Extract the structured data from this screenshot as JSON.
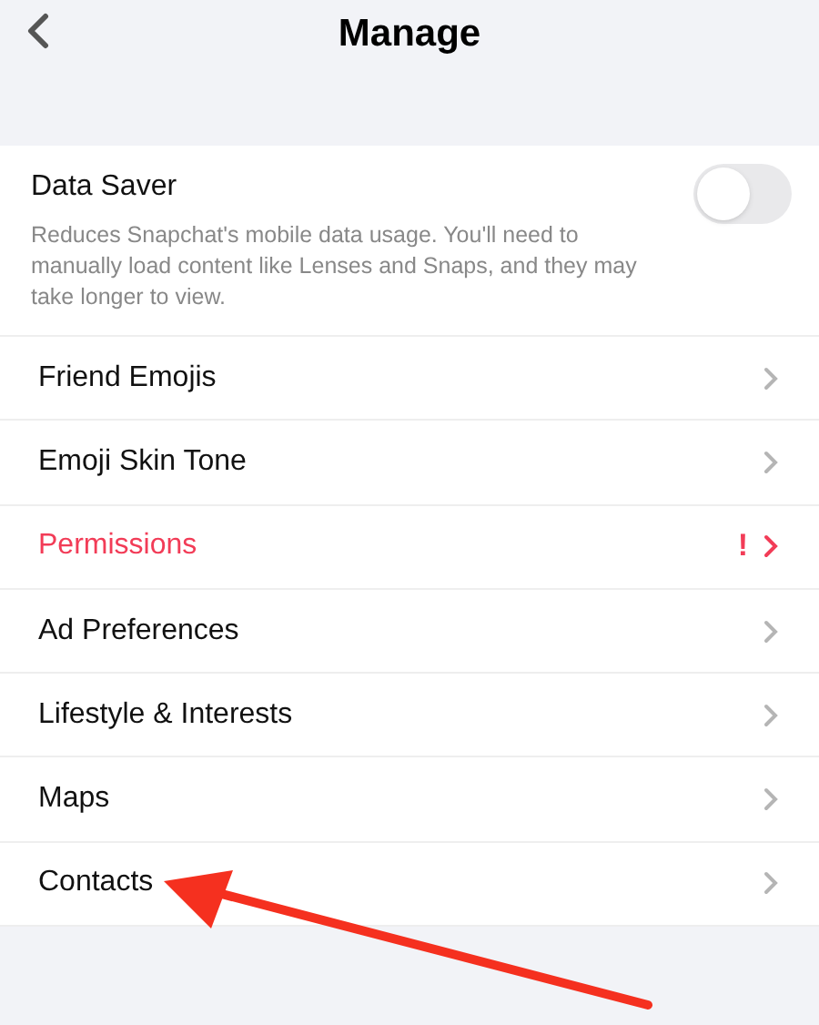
{
  "header": {
    "title": "Manage"
  },
  "data_saver": {
    "label": "Data Saver",
    "on": false,
    "description": "Reduces Snapchat's mobile data usage. You'll need to manually load content like Lenses and Snaps, and they may take longer to view."
  },
  "items": [
    {
      "label": "Friend Emojis",
      "kind": "normal"
    },
    {
      "label": "Emoji Skin Tone",
      "kind": "normal"
    },
    {
      "label": "Permissions",
      "kind": "warning",
      "badge": "!"
    },
    {
      "label": "Ad Preferences",
      "kind": "normal"
    },
    {
      "label": "Lifestyle & Interests",
      "kind": "normal"
    },
    {
      "label": "Maps",
      "kind": "normal"
    },
    {
      "label": "Contacts",
      "kind": "normal"
    }
  ]
}
